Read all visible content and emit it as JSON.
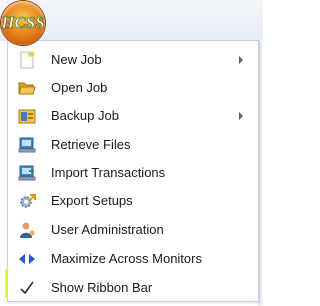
{
  "app": {
    "logo_text": "HCSS"
  },
  "menu": {
    "items": [
      {
        "label": "New Job",
        "icon": "new-document-icon",
        "submenu": true
      },
      {
        "label": "Open Job",
        "icon": "open-folder-icon",
        "submenu": false
      },
      {
        "label": "Backup Job",
        "icon": "backup-icon",
        "submenu": true
      },
      {
        "label": "Retrieve Files",
        "icon": "retrieve-computer-icon",
        "submenu": false
      },
      {
        "label": "Import Transactions",
        "icon": "import-computer-icon",
        "submenu": false
      },
      {
        "label": "Export Setups",
        "icon": "export-gear-icon",
        "submenu": false
      },
      {
        "label": "User Administration",
        "icon": "user-admin-icon",
        "submenu": false
      },
      {
        "label": "Maximize Across Monitors",
        "icon": "maximize-arrows-icon",
        "submenu": false
      },
      {
        "label": "Show Ribbon Bar",
        "icon": "checkmark-icon",
        "submenu": false,
        "checked": true
      }
    ]
  },
  "colors": {
    "highlight": "#f6f836",
    "orb": "#e47a17",
    "checkmark": "#2f2f2f"
  }
}
